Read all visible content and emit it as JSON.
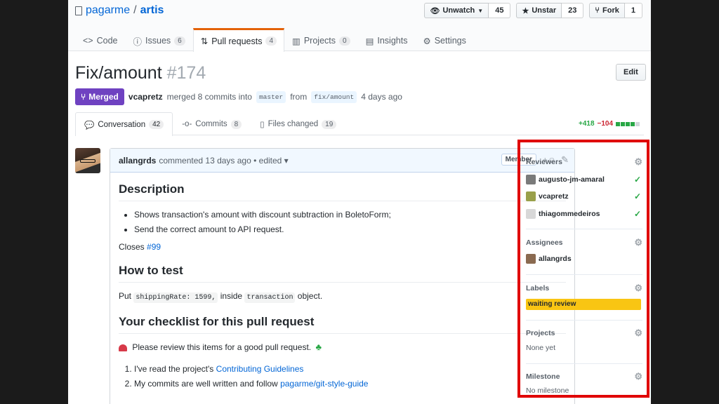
{
  "repo": {
    "owner": "pagarme",
    "separator": "/",
    "name": "artis"
  },
  "actions": {
    "watch": {
      "label": "Unwatch",
      "count": "45"
    },
    "star": {
      "label": "Unstar",
      "count": "23"
    },
    "fork": {
      "label": "Fork",
      "count": "1"
    }
  },
  "repo_tabs": [
    {
      "label": "Code",
      "icon": "code-icon"
    },
    {
      "label": "Issues",
      "badge": "6",
      "icon": "issue-icon"
    },
    {
      "label": "Pull requests",
      "badge": "4",
      "icon": "pull-request-icon"
    },
    {
      "label": "Projects",
      "badge": "0",
      "icon": "project-icon"
    },
    {
      "label": "Insights",
      "icon": "graph-icon"
    },
    {
      "label": "Settings",
      "icon": "gear-icon"
    }
  ],
  "pr": {
    "title": "Fix/amount",
    "number": "#174",
    "edit_label": "Edit",
    "state": "Merged",
    "author": "vcapretz",
    "merged_text": "merged 8 commits into",
    "base": "master",
    "from_text": "from",
    "head": "fix/amount",
    "time": "4 days ago"
  },
  "pr_tabs": [
    {
      "label": "Conversation",
      "badge": "42"
    },
    {
      "label": "Commits",
      "badge": "8"
    },
    {
      "label": "Files changed",
      "badge": "19"
    }
  ],
  "diffstat": {
    "additions": "+418",
    "deletions": "−104",
    "colors": [
      "#28a745",
      "#28a745",
      "#28a745",
      "#28a745",
      "#d1d5da"
    ]
  },
  "comment": {
    "author": "allangrds",
    "action": "commented 13 days ago • edited ▾",
    "role": "Member",
    "h_description": "Description",
    "desc_items": [
      "Shows transaction's amount with discount subtraction in BoletoForm;",
      "Send the correct amount to API request."
    ],
    "closes_text": "Closes",
    "closes_link": "#99",
    "h_test": "How to test",
    "test_put": "Put",
    "test_code1": "shippingRate: 1599,",
    "test_inside": "inside",
    "test_code2": "transaction",
    "test_object": "object.",
    "h_checklist": "Your checklist for this pull request",
    "review_note": "Please review this items for a good pull request.",
    "check_items": [
      {
        "text": "I've read the project's",
        "link": "Contributing Guidelines"
      },
      {
        "text": "My commits are well written and follow",
        "link": "pagarme/git-style-guide"
      }
    ]
  },
  "sidebar": {
    "reviewers": {
      "title": "Reviewers",
      "users": [
        "augusto-jm-amaral",
        "vcapretz",
        "thiagommedeiros"
      ]
    },
    "assignees": {
      "title": "Assignees",
      "users": [
        "allangrds"
      ]
    },
    "labels": {
      "title": "Labels",
      "items": [
        "waiting review"
      ],
      "label_color": "#f9c513"
    },
    "projects": {
      "title": "Projects",
      "empty": "None yet"
    },
    "milestone": {
      "title": "Milestone",
      "empty": "No milestone"
    }
  },
  "colors": {
    "accent": "#0366d6",
    "merged": "#6f42c1",
    "highlight_border": "#e00000"
  }
}
